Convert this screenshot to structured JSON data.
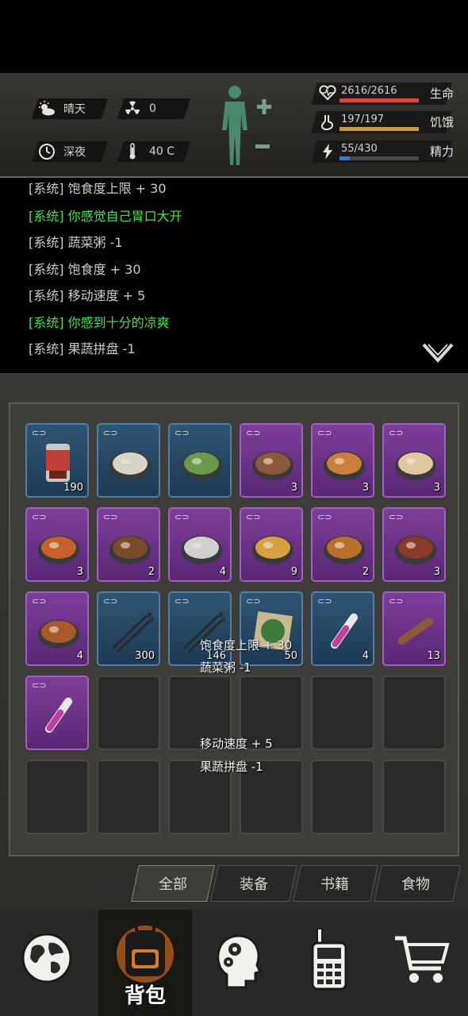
{
  "status": {
    "weather": "晴天",
    "radiation": "0",
    "time_of_day": "深夜",
    "temperature": "40 C",
    "health": {
      "value": "2616/2616",
      "label": "生命",
      "fraction": 1.0,
      "color": "#d94a3a"
    },
    "hunger": {
      "value": "197/197",
      "label": "饥饿",
      "fraction": 1.0,
      "color": "#c9964a"
    },
    "energy": {
      "value": "55/430",
      "label": "精力",
      "fraction": 0.128,
      "color": "#3c78c8"
    }
  },
  "log": [
    {
      "text": "[系统] 饱食度上限 + 30",
      "green": false
    },
    {
      "text": "[系统] 你感觉自己胃口大开",
      "green": true
    },
    {
      "text": "[系统] 蔬菜粥 -1",
      "green": false
    },
    {
      "text": "[系统] 饱食度 + 30",
      "green": false
    },
    {
      "text": "[系统] 移动速度 + 5",
      "green": false
    },
    {
      "text": "[系统] 你感到十分的凉爽",
      "green": true
    },
    {
      "text": "[系统] 果蔬拼盘 -1",
      "green": false
    }
  ],
  "inventory": [
    {
      "rarity": "blue",
      "count": "190",
      "icon": "canned-food-icon"
    },
    {
      "rarity": "blue",
      "count": "",
      "icon": "porridge-bowl-icon"
    },
    {
      "rarity": "blue",
      "count": "",
      "icon": "salad-platter-icon"
    },
    {
      "rarity": "purple",
      "count": "3",
      "icon": "fish-dish-icon"
    },
    {
      "rarity": "purple",
      "count": "3",
      "icon": "seafood-pot-icon"
    },
    {
      "rarity": "purple",
      "count": "3",
      "icon": "shrimp-soup-icon"
    },
    {
      "rarity": "purple",
      "count": "3",
      "icon": "crab-dish-icon"
    },
    {
      "rarity": "purple",
      "count": "2",
      "icon": "stew-pot-icon"
    },
    {
      "rarity": "purple",
      "count": "4",
      "icon": "sliced-meat-icon"
    },
    {
      "rarity": "purple",
      "count": "9",
      "icon": "fried-chicken-icon"
    },
    {
      "rarity": "purple",
      "count": "2",
      "icon": "braised-meat-icon"
    },
    {
      "rarity": "purple",
      "count": "3",
      "icon": "meatball-plate-icon"
    },
    {
      "rarity": "purple",
      "count": "4",
      "icon": "hotpot-icon"
    },
    {
      "rarity": "blue",
      "count": "300",
      "icon": "arrows-icon"
    },
    {
      "rarity": "blue",
      "count": "146",
      "icon": "arrows-icon"
    },
    {
      "rarity": "blue",
      "count": "50",
      "icon": "herb-cloth-icon"
    },
    {
      "rarity": "blue",
      "count": "4",
      "icon": "potion-tube-icon"
    },
    {
      "rarity": "purple",
      "count": "13",
      "icon": "wooden-stick-icon"
    },
    {
      "rarity": "purple",
      "count": "",
      "icon": "potion-tube-icon"
    }
  ],
  "floating_text": [
    "饱食度上限 + 30",
    "蔬菜粥 -1",
    "移动速度 + 5",
    "果蔬拼盘 -1"
  ],
  "tabs": [
    "全部",
    "装备",
    "书籍",
    "食物"
  ],
  "nav": {
    "backpack_label": "背包"
  },
  "icons": [
    "weather-sun-cloud-icon",
    "radiation-icon",
    "clock-icon",
    "thermometer-icon",
    "heart-icon",
    "stomach-icon",
    "lightning-icon",
    "globe-icon",
    "backpack-icon",
    "head-gears-icon",
    "walkie-talkie-icon",
    "cart-icon",
    "chevron-down-icon"
  ]
}
